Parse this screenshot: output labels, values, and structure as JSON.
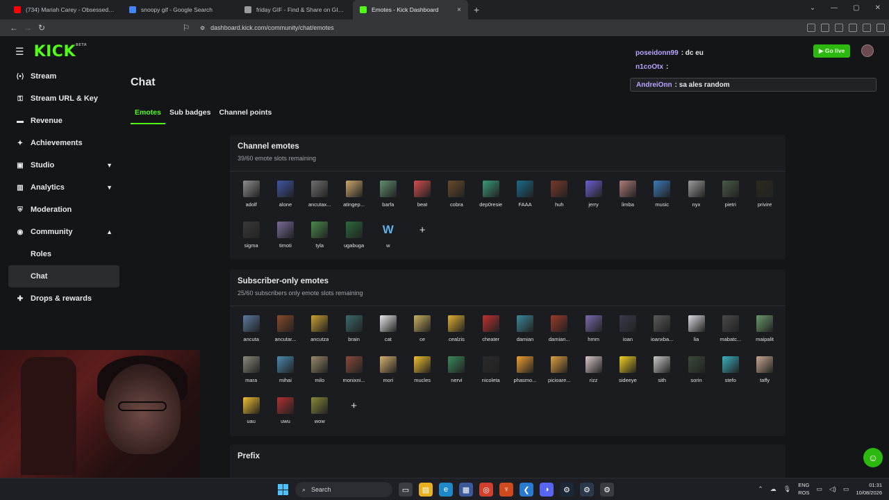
{
  "browser": {
    "tabs": [
      {
        "title": "(734) Mariah Carey - Obsessed (C",
        "color": "#ff0000"
      },
      {
        "title": "snoopy gif - Google Search",
        "color": "#4285f4"
      },
      {
        "title": "friday GIF - Find & Share on GIPHY",
        "color": "#9b9b9b"
      },
      {
        "title": "Emotes - Kick Dashboard",
        "color": "#53fc18",
        "close": "×"
      }
    ],
    "new_tab": "+",
    "url": "dashboard.kick.com/community/chat/emotes"
  },
  "logo": {
    "text": "KICK",
    "badge": "BETA"
  },
  "sidebar": {
    "items": [
      {
        "label": "Stream",
        "icon": "stream-icon",
        "glyph": "⟨•⟩"
      },
      {
        "label": "Stream URL & Key",
        "icon": "key-icon",
        "glyph": "⚿"
      },
      {
        "label": "Revenue",
        "icon": "revenue-icon",
        "glyph": "▬"
      },
      {
        "label": "Achievements",
        "icon": "trophy-icon",
        "glyph": "✦"
      },
      {
        "label": "Studio",
        "icon": "studio-icon",
        "glyph": "▣",
        "chevron": "▼"
      },
      {
        "label": "Analytics",
        "icon": "analytics-icon",
        "glyph": "▥",
        "chevron": "▼"
      },
      {
        "label": "Moderation",
        "icon": "moderation-icon",
        "glyph": "⛨"
      },
      {
        "label": "Community",
        "icon": "community-icon",
        "glyph": "◉",
        "chevron": "▲"
      },
      {
        "label": "Roles",
        "sub": true
      },
      {
        "label": "Chat",
        "sub": true,
        "active": true
      },
      {
        "label": "Drops & rewards",
        "icon": "gift-icon",
        "glyph": "✚"
      }
    ]
  },
  "main": {
    "title": "Chat",
    "tabs": [
      "Emotes",
      "Sub badges",
      "Channel points"
    ],
    "channel": {
      "title": "Channel emotes",
      "subtitle": "39/60 emote slots remaining",
      "emotes": [
        {
          "name": "adolf",
          "color": "#8d8d8d"
        },
        {
          "name": "alone",
          "color": "#3e56a6"
        },
        {
          "name": "ancutax...",
          "color": "#6f6f6f"
        },
        {
          "name": "atingep...",
          "color": "#c9a86a"
        },
        {
          "name": "barfa",
          "color": "#5f8f6e"
        },
        {
          "name": "beat",
          "color": "#d24d4d"
        },
        {
          "name": "cobra",
          "color": "#6a4a2a"
        },
        {
          "name": "dep0resie",
          "color": "#3a9a7a"
        },
        {
          "name": "FAAA",
          "color": "#1b6b8a"
        },
        {
          "name": "huh",
          "color": "#7a3a2a"
        },
        {
          "name": "jerry",
          "color": "#6a5fd0"
        },
        {
          "name": "limba",
          "color": "#b07a7a"
        },
        {
          "name": "music",
          "color": "#3a7ab8"
        },
        {
          "name": "nyx",
          "color": "#9a9a9a"
        },
        {
          "name": "pietri",
          "color": "#4a5a4a"
        },
        {
          "name": "privire",
          "color": "#2a2a1a"
        },
        {
          "name": "sigma",
          "color": "#3a3a3a"
        },
        {
          "name": "timoti",
          "color": "#7a6a9a"
        },
        {
          "name": "tyla",
          "color": "#4a8a4a"
        },
        {
          "name": "ugabuga",
          "color": "#2a6a3a"
        },
        {
          "name": "w",
          "type": "w",
          "glyph": "W"
        },
        {
          "name": "",
          "type": "plus",
          "glyph": "+"
        }
      ]
    },
    "subscriber": {
      "title": "Subscriber-only emotes",
      "subtitle": "25/60 subscribers only emote slots remaining",
      "emotes": [
        {
          "name": "ancuta",
          "color": "#5a7aa0"
        },
        {
          "name": "ancutar...",
          "color": "#8a4a2a"
        },
        {
          "name": "ancutza",
          "color": "#c9a030"
        },
        {
          "name": "brain",
          "color": "#3a6a6a"
        },
        {
          "name": "cat",
          "color": "#e8e8e8"
        },
        {
          "name": "ce",
          "color": "#c8b060"
        },
        {
          "name": "cealzis",
          "color": "#e0b030"
        },
        {
          "name": "cheater",
          "color": "#c03030"
        },
        {
          "name": "damian",
          "color": "#3a8a9a"
        },
        {
          "name": "damian...",
          "color": "#9a3a2a"
        },
        {
          "name": "hmm",
          "color": "#7a6ab0"
        },
        {
          "name": "ioan",
          "color": "#3a3a4a"
        },
        {
          "name": "ioanxba...",
          "color": "#5a5a5a"
        },
        {
          "name": "lia",
          "color": "#d8d8e0"
        },
        {
          "name": "mabatc...",
          "color": "#4a4a4a"
        },
        {
          "name": "maipalit",
          "color": "#6a9a6a"
        },
        {
          "name": "mara",
          "color": "#8a8a7a"
        },
        {
          "name": "mihai",
          "color": "#4a8ab0"
        },
        {
          "name": "milo",
          "color": "#9a8a6a"
        },
        {
          "name": "monixni...",
          "color": "#8a4a3a"
        },
        {
          "name": "mori",
          "color": "#d8b070"
        },
        {
          "name": "mucles",
          "color": "#f0c030"
        },
        {
          "name": "nervi",
          "color": "#3a8a5a"
        },
        {
          "name": "nicoleta",
          "color": "#2a2a2a"
        },
        {
          "name": "phasmo...",
          "color": "#f0a030"
        },
        {
          "name": "picioare...",
          "color": "#e0a040"
        },
        {
          "name": "rizz",
          "color": "#d8c8c8"
        },
        {
          "name": "sideeye",
          "color": "#f0d020"
        },
        {
          "name": "sith",
          "color": "#c8c8c8"
        },
        {
          "name": "sorin",
          "color": "#3a4a3a"
        },
        {
          "name": "stefo",
          "color": "#3ab0c0"
        },
        {
          "name": "taffy",
          "color": "#c8a890"
        },
        {
          "name": "uau",
          "color": "#f0c030"
        },
        {
          "name": "uwu",
          "color": "#b03030"
        },
        {
          "name": "wow",
          "color": "#8a8a3a"
        },
        {
          "name": "",
          "type": "plus",
          "glyph": "+"
        }
      ]
    },
    "prefix_title": "Prefix"
  },
  "chat_overlay": [
    {
      "user": "poseidonn99",
      "text": ": dc eu",
      "box": false
    },
    {
      "user": "n1coOtx",
      "text": ":",
      "box": false
    },
    {
      "user": "AndreiOnn",
      "text": " : sa ales random",
      "box": true
    }
  ],
  "header": {
    "go_live": "Go live"
  },
  "taskbar": {
    "search": "Search",
    "lang1": "ENG",
    "lang2": "ROS",
    "time": "01:31",
    "date": "10/08/2026"
  },
  "colors": {
    "accent": "#53fc18",
    "bg": "#141517",
    "panel": "#1b1c1f"
  }
}
